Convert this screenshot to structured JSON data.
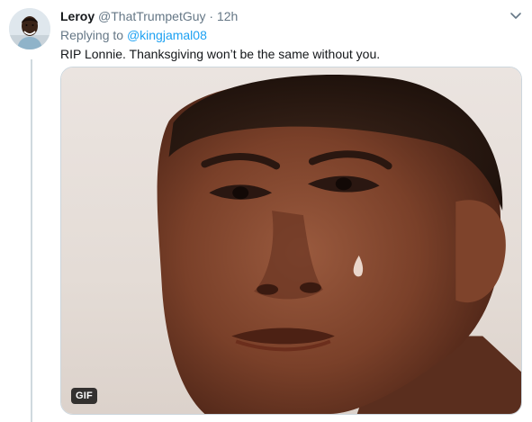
{
  "tweet": {
    "display_name": "Leroy",
    "handle": "@ThatTrumpetGuy",
    "separator": "·",
    "time": "12h",
    "replying_prefix": "Replying to",
    "replying_to": "@kingjamal08",
    "text": "RIP Lonnie. Thanksgiving won’t be the same without you.",
    "media": {
      "badge": "GIF",
      "icon": "crying-boy-gif"
    }
  },
  "icons": {
    "menu": "chevron-down-icon",
    "avatar": "avatar"
  },
  "colors": {
    "name": "#14171a",
    "secondary": "#657786",
    "link": "#1da1f2",
    "thread_line": "#cfd9de",
    "border": "#ccd6dd"
  }
}
